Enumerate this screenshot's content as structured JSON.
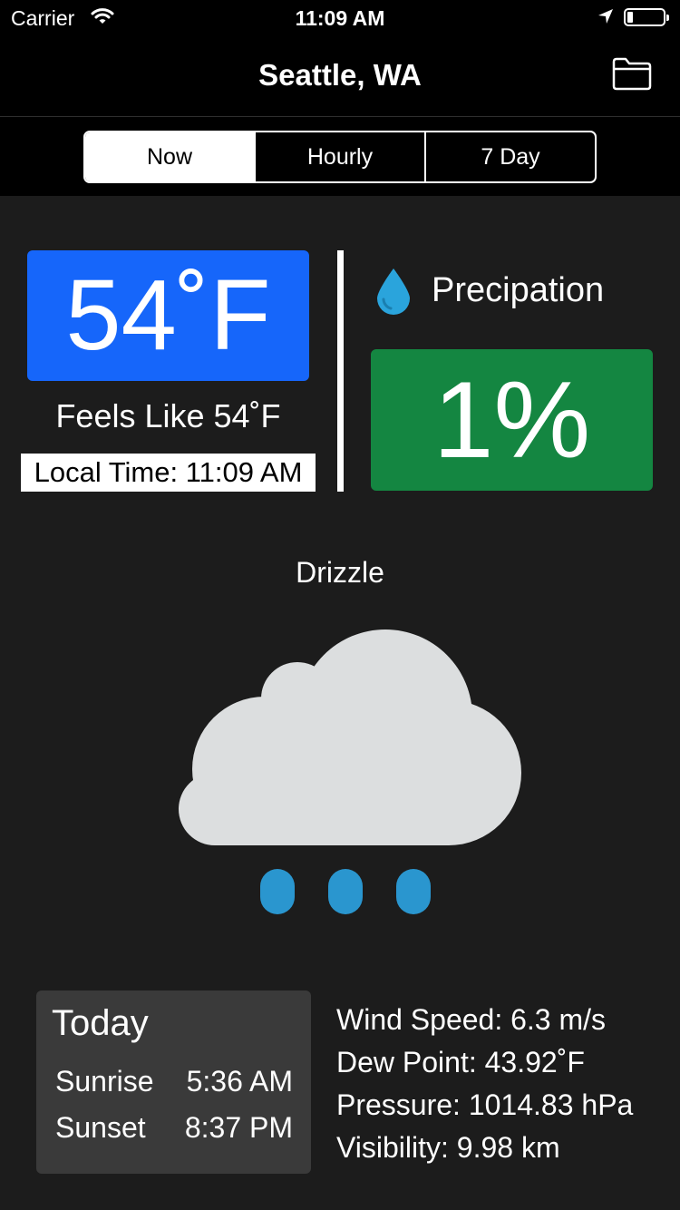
{
  "status_bar": {
    "carrier": "Carrier",
    "time": "11:09 AM"
  },
  "nav": {
    "title": "Seattle, WA",
    "action_icon": "folder-icon"
  },
  "tabs": [
    {
      "label": "Now",
      "selected": true
    },
    {
      "label": "Hourly",
      "selected": false
    },
    {
      "label": "7 Day",
      "selected": false
    }
  ],
  "current": {
    "temperature": "54˚F",
    "feels_like": "Feels Like 54˚F",
    "local_time": "Local Time: 11:09 AM",
    "temp_box_color": "#1666fa"
  },
  "precipitation": {
    "label": "Precipation",
    "value": "1%",
    "icon": "water-drop-icon",
    "box_color": "#148641"
  },
  "condition": {
    "text": "Drizzle",
    "icon": "drizzle-cloud-icon"
  },
  "today": {
    "title": "Today",
    "sunrise_label": "Sunrise",
    "sunrise_time": "5:36 AM",
    "sunset_label": "Sunset",
    "sunset_time": "8:37 PM"
  },
  "stats": {
    "wind_speed": "Wind Speed: 6.3 m/s",
    "dew_point": "Dew Point: 43.92˚F",
    "pressure": "Pressure: 1014.83 hPa",
    "visibility": "Visibility: 9.98 km"
  }
}
